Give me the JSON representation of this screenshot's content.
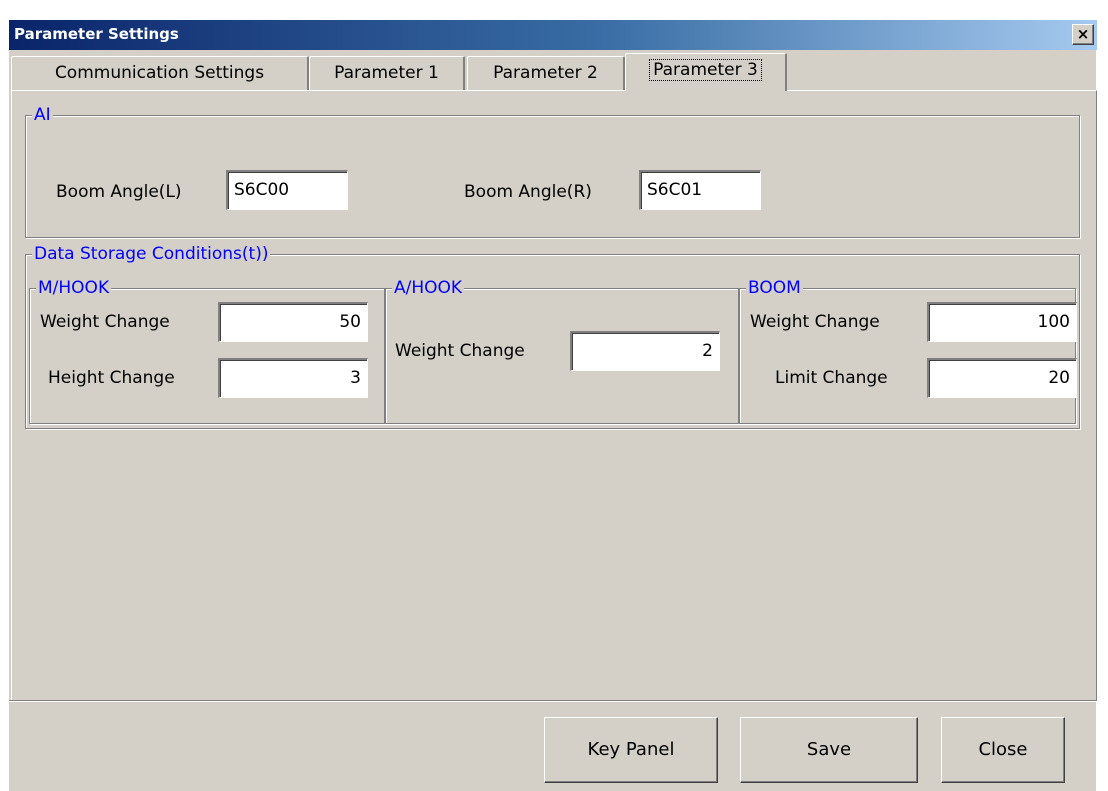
{
  "window": {
    "title": "Parameter Settings",
    "close_label": "×"
  },
  "tabs": [
    {
      "label": "Communication Settings"
    },
    {
      "label": "Parameter 1"
    },
    {
      "label": "Parameter 2"
    },
    {
      "label": "Parameter 3",
      "active": true
    }
  ],
  "ai": {
    "title": "AI",
    "boom_angle_l": {
      "label": "Boom Angle(L)",
      "value": "S6C00"
    },
    "boom_angle_r": {
      "label": "Boom Angle(R)",
      "value": "S6C01"
    }
  },
  "storage": {
    "title": "Data Storage Conditions(t))",
    "m_hook": {
      "title": "M/HOOK",
      "weight_change": {
        "label": "Weight Change",
        "value": "50"
      },
      "height_change": {
        "label": "Height Change",
        "value": "3"
      }
    },
    "a_hook": {
      "title": "A/HOOK",
      "weight_change": {
        "label": "Weight Change",
        "value": "2"
      }
    },
    "boom": {
      "title": "BOOM",
      "weight_change": {
        "label": "Weight Change",
        "value": "100"
      },
      "limit_change": {
        "label": "Limit Change",
        "value": "20"
      }
    }
  },
  "buttons": {
    "key_panel": "Key Panel",
    "save": "Save",
    "close": "Close"
  }
}
